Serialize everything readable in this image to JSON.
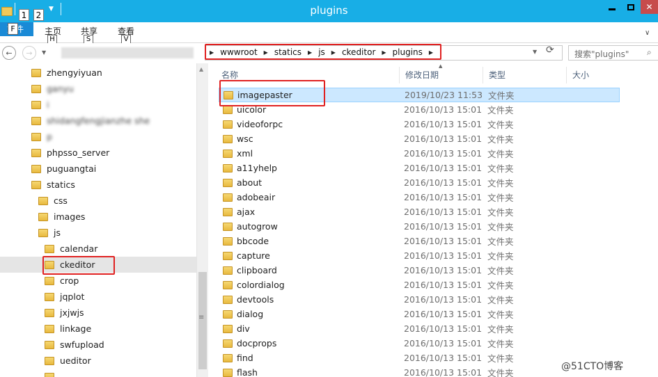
{
  "window": {
    "title": "plugins",
    "quick_access_keys": [
      "1",
      "2"
    ]
  },
  "ribbon": {
    "file_label": "文件",
    "file_key": "F",
    "tabs": [
      {
        "label": "主页",
        "key": "H"
      },
      {
        "label": "共享",
        "key": "S"
      },
      {
        "label": "查看",
        "key": "V"
      }
    ]
  },
  "address": {
    "crumbs": [
      "wwwroot",
      "statics",
      "js",
      "ckeditor",
      "plugins"
    ]
  },
  "search": {
    "placeholder": "搜索\"plugins\""
  },
  "nav_tree": [
    {
      "label": "zhengyiyuan",
      "blurred": false,
      "indent": 1
    },
    {
      "label": "ganyu",
      "blurred": true,
      "indent": 1
    },
    {
      "label": "i",
      "blurred": true,
      "indent": 1
    },
    {
      "label": "shidangfengjianzhe she",
      "blurred": true,
      "indent": 1
    },
    {
      "label": "p",
      "blurred": true,
      "indent": 1
    },
    {
      "label": "phpsso_server",
      "blurred": false,
      "indent": 1
    },
    {
      "label": "puguangtai",
      "blurred": false,
      "indent": 1
    },
    {
      "label": "statics",
      "blurred": false,
      "indent": 1
    },
    {
      "label": "css",
      "blurred": false,
      "indent": 2
    },
    {
      "label": "images",
      "blurred": false,
      "indent": 2
    },
    {
      "label": "js",
      "blurred": false,
      "indent": 2
    },
    {
      "label": "calendar",
      "blurred": false,
      "indent": 3
    },
    {
      "label": "ckeditor",
      "blurred": false,
      "indent": 3,
      "selected": true
    },
    {
      "label": "crop",
      "blurred": false,
      "indent": 3
    },
    {
      "label": "jqplot",
      "blurred": false,
      "indent": 3
    },
    {
      "label": "jxjwjs",
      "blurred": false,
      "indent": 3
    },
    {
      "label": "linkage",
      "blurred": false,
      "indent": 3
    },
    {
      "label": "swfupload",
      "blurred": false,
      "indent": 3
    },
    {
      "label": "ueditor",
      "blurred": false,
      "indent": 3
    },
    {
      "label": "",
      "blurred": false,
      "indent": 3
    }
  ],
  "columns": {
    "name": "名称",
    "date": "修改日期",
    "type": "类型",
    "size": "大小"
  },
  "files": [
    {
      "name": "imagepaster",
      "date": "2019/10/23 11:53",
      "type": "文件夹",
      "selected": true
    },
    {
      "name": "uicolor",
      "date": "2016/10/13 15:01",
      "type": "文件夹"
    },
    {
      "name": "videoforpc",
      "date": "2016/10/13 15:01",
      "type": "文件夹"
    },
    {
      "name": "wsc",
      "date": "2016/10/13 15:01",
      "type": "文件夹"
    },
    {
      "name": "xml",
      "date": "2016/10/13 15:01",
      "type": "文件夹"
    },
    {
      "name": "a11yhelp",
      "date": "2016/10/13 15:01",
      "type": "文件夹"
    },
    {
      "name": "about",
      "date": "2016/10/13 15:01",
      "type": "文件夹"
    },
    {
      "name": "adobeair",
      "date": "2016/10/13 15:01",
      "type": "文件夹"
    },
    {
      "name": "ajax",
      "date": "2016/10/13 15:01",
      "type": "文件夹"
    },
    {
      "name": "autogrow",
      "date": "2016/10/13 15:01",
      "type": "文件夹"
    },
    {
      "name": "bbcode",
      "date": "2016/10/13 15:01",
      "type": "文件夹"
    },
    {
      "name": "capture",
      "date": "2016/10/13 15:01",
      "type": "文件夹"
    },
    {
      "name": "clipboard",
      "date": "2016/10/13 15:01",
      "type": "文件夹"
    },
    {
      "name": "colordialog",
      "date": "2016/10/13 15:01",
      "type": "文件夹"
    },
    {
      "name": "devtools",
      "date": "2016/10/13 15:01",
      "type": "文件夹"
    },
    {
      "name": "dialog",
      "date": "2016/10/13 15:01",
      "type": "文件夹"
    },
    {
      "name": "div",
      "date": "2016/10/13 15:01",
      "type": "文件夹"
    },
    {
      "name": "docprops",
      "date": "2016/10/13 15:01",
      "type": "文件夹"
    },
    {
      "name": "find",
      "date": "2016/10/13 15:01",
      "type": "文件夹"
    },
    {
      "name": "flash",
      "date": "2016/10/13 15:01",
      "type": "文件夹"
    }
  ],
  "watermark": "@51CTO博客",
  "colors": {
    "titlebar": "#18aee6",
    "selection": "#cce8ff",
    "annotation": "#e02020"
  }
}
